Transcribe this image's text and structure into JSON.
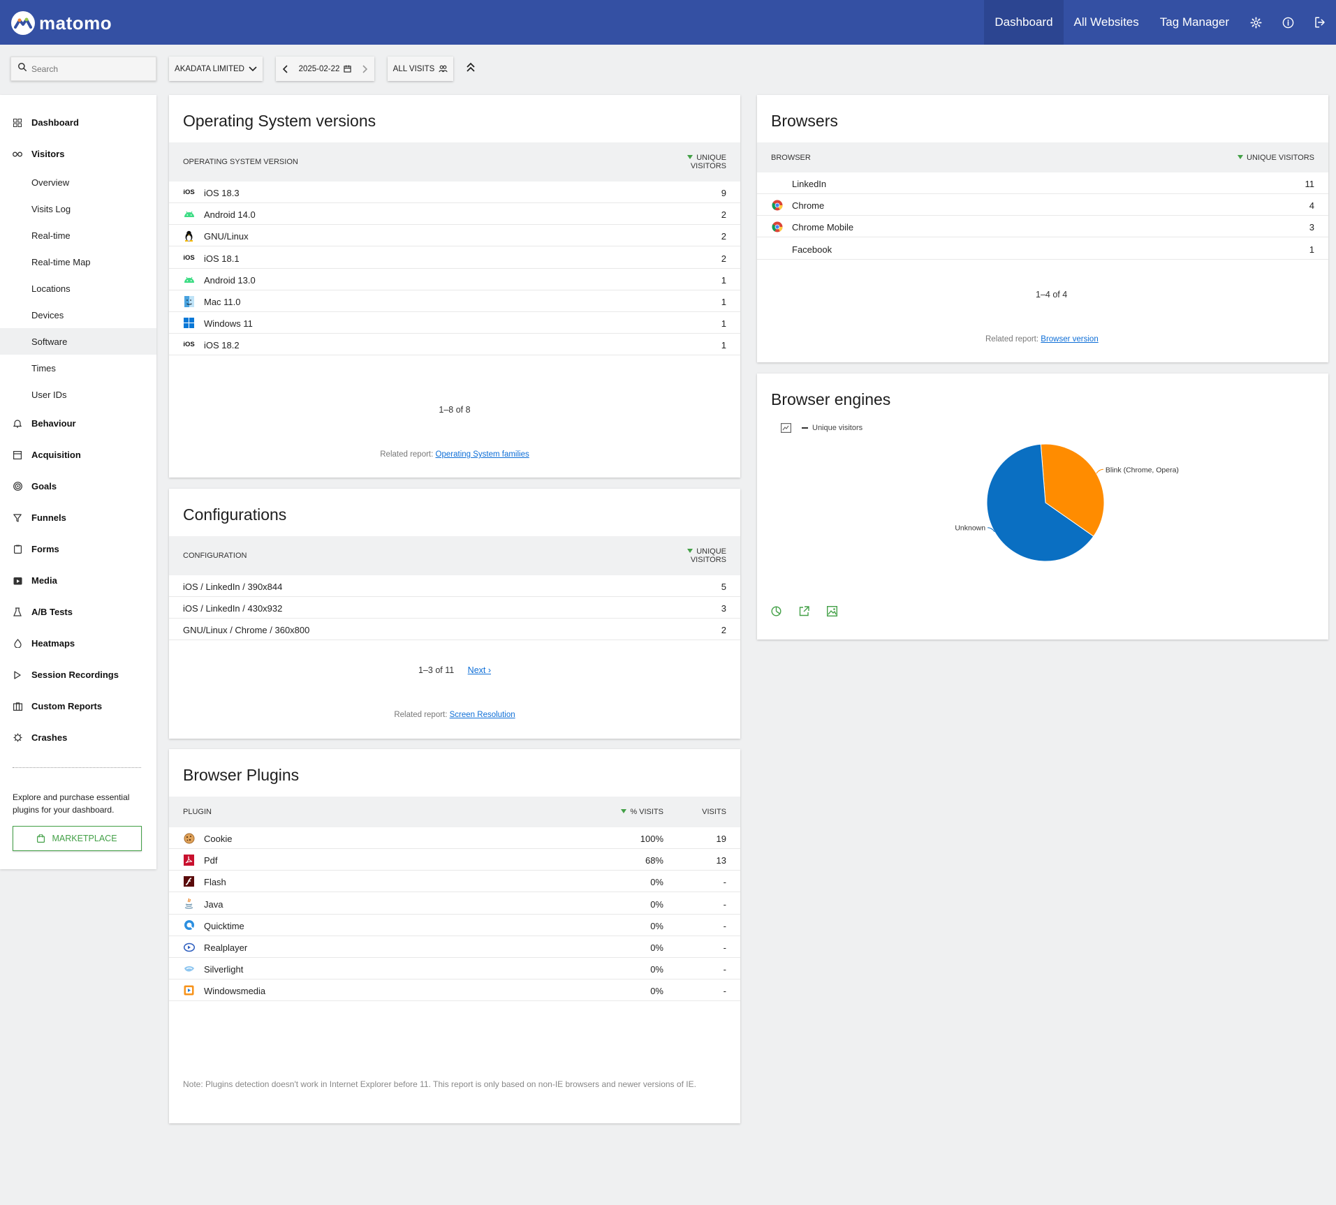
{
  "app": {
    "brand": "matomo",
    "nav": {
      "dashboard": "Dashboard",
      "all_websites": "All Websites",
      "tag_manager": "Tag Manager"
    },
    "colors": {
      "header": "#3450a3",
      "accent": "#43a047",
      "link": "#0d6ed7",
      "pie_blue": "#0a6fc2",
      "pie_orange": "#ff8c00"
    }
  },
  "toolbar": {
    "search_placeholder": "Search",
    "site": "AKADATA LIMITED",
    "date": "2025-02-22",
    "segment": "ALL VISITS"
  },
  "sidebar": {
    "categories": {
      "dashboard": "Dashboard",
      "visitors": "Visitors",
      "behaviour": "Behaviour",
      "acquisition": "Acquisition",
      "goals": "Goals",
      "funnels": "Funnels",
      "forms": "Forms",
      "media": "Media",
      "ab_tests": "A/B Tests",
      "heatmaps": "Heatmaps",
      "session_recordings": "Session Recordings",
      "custom_reports": "Custom Reports",
      "crashes": "Crashes"
    },
    "visitors_items": [
      "Overview",
      "Visits Log",
      "Real-time",
      "Real-time Map",
      "Locations",
      "Devices",
      "Software",
      "Times",
      "User IDs"
    ],
    "active_item": "Software",
    "promo_text": "Explore and purchase essential plugins for your dashboard.",
    "marketplace_label": "MARKETPLACE"
  },
  "os_versions": {
    "title": "Operating System versions",
    "col_label": "OPERATING SYSTEM VERSION",
    "col_value": "UNIQUE VISITORS",
    "rows": [
      {
        "icon": "ios-icon",
        "label": "iOS 18.3",
        "value": "9"
      },
      {
        "icon": "android-icon",
        "label": "Android 14.0",
        "value": "2"
      },
      {
        "icon": "linux-icon",
        "label": "GNU/Linux",
        "value": "2"
      },
      {
        "icon": "ios-icon",
        "label": "iOS 18.1",
        "value": "2"
      },
      {
        "icon": "android-icon",
        "label": "Android 13.0",
        "value": "1"
      },
      {
        "icon": "mac-icon",
        "label": "Mac 11.0",
        "value": "1"
      },
      {
        "icon": "windows-icon",
        "label": "Windows 11",
        "value": "1"
      },
      {
        "icon": "ios-icon",
        "label": "iOS 18.2",
        "value": "1"
      }
    ],
    "pager": "1–8 of 8",
    "related_prefix": "Related report:",
    "related_link": "Operating System families"
  },
  "configurations": {
    "title": "Configurations",
    "col_label": "CONFIGURATION",
    "col_value": "UNIQUE VISITORS",
    "rows": [
      {
        "label": "iOS / LinkedIn / 390x844",
        "value": "5"
      },
      {
        "label": "iOS / LinkedIn / 430x932",
        "value": "3"
      },
      {
        "label": "GNU/Linux / Chrome / 360x800",
        "value": "2"
      }
    ],
    "pager": "1–3 of 11",
    "next": "Next ›",
    "related_prefix": "Related report:",
    "related_link": "Screen Resolution"
  },
  "plugins": {
    "title": "Browser Plugins",
    "col_label": "PLUGIN",
    "col_pct": "% VISITS",
    "col_visits": "VISITS",
    "rows": [
      {
        "icon": "cookie-icon",
        "label": "Cookie",
        "pct": "100%",
        "visits": "19"
      },
      {
        "icon": "pdf-icon",
        "label": "Pdf",
        "pct": "68%",
        "visits": "13"
      },
      {
        "icon": "flash-icon",
        "label": "Flash",
        "pct": "0%",
        "visits": "-"
      },
      {
        "icon": "java-icon",
        "label": "Java",
        "pct": "0%",
        "visits": "-"
      },
      {
        "icon": "quicktime-icon",
        "label": "Quicktime",
        "pct": "0%",
        "visits": "-"
      },
      {
        "icon": "realplayer-icon",
        "label": "Realplayer",
        "pct": "0%",
        "visits": "-"
      },
      {
        "icon": "silverlight-icon",
        "label": "Silverlight",
        "pct": "0%",
        "visits": "-"
      },
      {
        "icon": "windowsmedia-icon",
        "label": "Windowsmedia",
        "pct": "0%",
        "visits": "-"
      }
    ],
    "note": "Note: Plugins detection doesn't work in Internet Explorer before 11. This report is only based on non-IE browsers and newer versions of IE."
  },
  "browsers": {
    "title": "Browsers",
    "col_label": "BROWSER",
    "col_value": "UNIQUE VISITORS",
    "rows": [
      {
        "icon": "",
        "label": "LinkedIn",
        "value": "11"
      },
      {
        "icon": "chrome-icon",
        "label": "Chrome",
        "value": "4"
      },
      {
        "icon": "chrome-icon",
        "label": "Chrome Mobile",
        "value": "3"
      },
      {
        "icon": "",
        "label": "Facebook",
        "value": "1"
      }
    ],
    "pager": "1–4 of 4",
    "related_prefix": "Related report:",
    "related_link": "Browser version"
  },
  "engines": {
    "title": "Browser engines",
    "legend": "Unique visitors",
    "chart_data": {
      "type": "pie",
      "slices": [
        {
          "name": "Blink (Chrome, Opera)",
          "value": 36,
          "color": "#ff8c00"
        },
        {
          "name": "Unknown",
          "value": 64,
          "color": "#0a6fc2"
        }
      ]
    }
  }
}
